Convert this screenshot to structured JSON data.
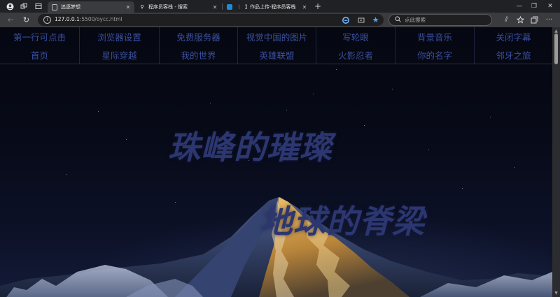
{
  "browser": {
    "tabs": [
      {
        "title": "追逐梦想",
        "active": true
      },
      {
        "title": "程序员客栈 - 搜索",
        "active": false
      },
      {
        "title": "【",
        "active": false
      },
      {
        "title": "】作品上传-程序员客栈",
        "active": false
      }
    ],
    "address": {
      "host": "127.0.0.1",
      "rest": ":5500/oycc.html"
    },
    "search_placeholder": "点此搜索",
    "icons": {
      "profile": "profile-icon",
      "workspaces": "workspaces-icon",
      "tab_actions": "tab-actions-icon",
      "new_tab": "plus-icon",
      "minimize": "minimize-icon",
      "restore": "restore-icon",
      "close": "close-icon",
      "back": "back-arrow-icon",
      "reload": "reload-icon",
      "info": "info-icon",
      "extension": "extension-icon",
      "read_aloud": "reader-icon",
      "favorite": "star-icon",
      "favorites": "favorites-icon",
      "collections": "collections-icon",
      "more": "more-icon"
    }
  },
  "page": {
    "menu_rows": [
      [
        "第一行可点击",
        "浏览器设置",
        "免费服务器",
        "视觉中国的图片",
        "写轮眼",
        "背景音乐",
        "关闭字幕"
      ],
      [
        "首页",
        "星际穿越",
        "我的世界",
        "英雄联盟",
        "火影忍者",
        "你的名字",
        "邻牙之旅"
      ]
    ],
    "headline_1": "珠峰的璀璨",
    "headline_2": "地球的脊梁"
  },
  "colors": {
    "menu_text": "#3a4fa0",
    "headline": "#2c3670",
    "sky_top": "#050711",
    "sky_bottom": "#141b38",
    "peak_sunlit": "#d9a34a",
    "snow": "#b9c3dc"
  }
}
